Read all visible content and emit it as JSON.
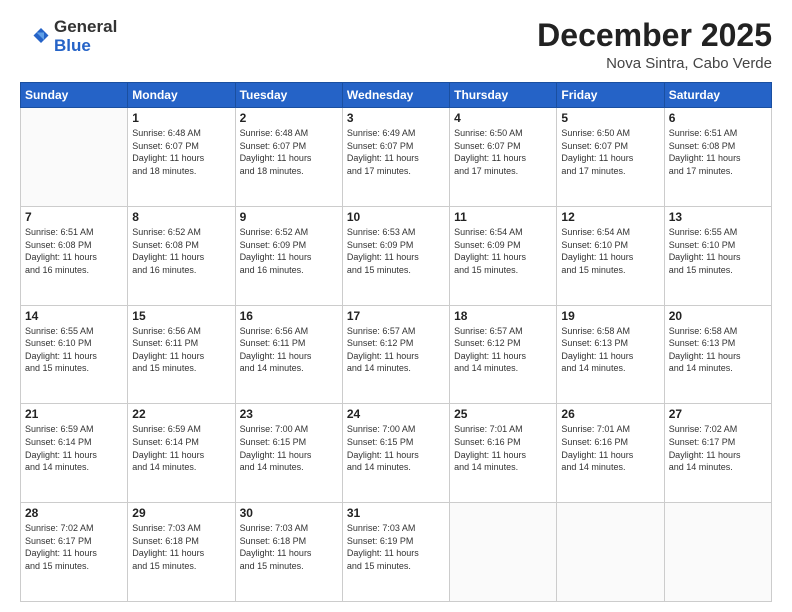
{
  "header": {
    "logo_general": "General",
    "logo_blue": "Blue",
    "month": "December 2025",
    "location": "Nova Sintra, Cabo Verde"
  },
  "weekdays": [
    "Sunday",
    "Monday",
    "Tuesday",
    "Wednesday",
    "Thursday",
    "Friday",
    "Saturday"
  ],
  "weeks": [
    [
      {
        "day": "",
        "info": ""
      },
      {
        "day": "1",
        "info": "Sunrise: 6:48 AM\nSunset: 6:07 PM\nDaylight: 11 hours\nand 18 minutes."
      },
      {
        "day": "2",
        "info": "Sunrise: 6:48 AM\nSunset: 6:07 PM\nDaylight: 11 hours\nand 18 minutes."
      },
      {
        "day": "3",
        "info": "Sunrise: 6:49 AM\nSunset: 6:07 PM\nDaylight: 11 hours\nand 17 minutes."
      },
      {
        "day": "4",
        "info": "Sunrise: 6:50 AM\nSunset: 6:07 PM\nDaylight: 11 hours\nand 17 minutes."
      },
      {
        "day": "5",
        "info": "Sunrise: 6:50 AM\nSunset: 6:07 PM\nDaylight: 11 hours\nand 17 minutes."
      },
      {
        "day": "6",
        "info": "Sunrise: 6:51 AM\nSunset: 6:08 PM\nDaylight: 11 hours\nand 17 minutes."
      }
    ],
    [
      {
        "day": "7",
        "info": "Sunrise: 6:51 AM\nSunset: 6:08 PM\nDaylight: 11 hours\nand 16 minutes."
      },
      {
        "day": "8",
        "info": "Sunrise: 6:52 AM\nSunset: 6:08 PM\nDaylight: 11 hours\nand 16 minutes."
      },
      {
        "day": "9",
        "info": "Sunrise: 6:52 AM\nSunset: 6:09 PM\nDaylight: 11 hours\nand 16 minutes."
      },
      {
        "day": "10",
        "info": "Sunrise: 6:53 AM\nSunset: 6:09 PM\nDaylight: 11 hours\nand 15 minutes."
      },
      {
        "day": "11",
        "info": "Sunrise: 6:54 AM\nSunset: 6:09 PM\nDaylight: 11 hours\nand 15 minutes."
      },
      {
        "day": "12",
        "info": "Sunrise: 6:54 AM\nSunset: 6:10 PM\nDaylight: 11 hours\nand 15 minutes."
      },
      {
        "day": "13",
        "info": "Sunrise: 6:55 AM\nSunset: 6:10 PM\nDaylight: 11 hours\nand 15 minutes."
      }
    ],
    [
      {
        "day": "14",
        "info": "Sunrise: 6:55 AM\nSunset: 6:10 PM\nDaylight: 11 hours\nand 15 minutes."
      },
      {
        "day": "15",
        "info": "Sunrise: 6:56 AM\nSunset: 6:11 PM\nDaylight: 11 hours\nand 15 minutes."
      },
      {
        "day": "16",
        "info": "Sunrise: 6:56 AM\nSunset: 6:11 PM\nDaylight: 11 hours\nand 14 minutes."
      },
      {
        "day": "17",
        "info": "Sunrise: 6:57 AM\nSunset: 6:12 PM\nDaylight: 11 hours\nand 14 minutes."
      },
      {
        "day": "18",
        "info": "Sunrise: 6:57 AM\nSunset: 6:12 PM\nDaylight: 11 hours\nand 14 minutes."
      },
      {
        "day": "19",
        "info": "Sunrise: 6:58 AM\nSunset: 6:13 PM\nDaylight: 11 hours\nand 14 minutes."
      },
      {
        "day": "20",
        "info": "Sunrise: 6:58 AM\nSunset: 6:13 PM\nDaylight: 11 hours\nand 14 minutes."
      }
    ],
    [
      {
        "day": "21",
        "info": "Sunrise: 6:59 AM\nSunset: 6:14 PM\nDaylight: 11 hours\nand 14 minutes."
      },
      {
        "day": "22",
        "info": "Sunrise: 6:59 AM\nSunset: 6:14 PM\nDaylight: 11 hours\nand 14 minutes."
      },
      {
        "day": "23",
        "info": "Sunrise: 7:00 AM\nSunset: 6:15 PM\nDaylight: 11 hours\nand 14 minutes."
      },
      {
        "day": "24",
        "info": "Sunrise: 7:00 AM\nSunset: 6:15 PM\nDaylight: 11 hours\nand 14 minutes."
      },
      {
        "day": "25",
        "info": "Sunrise: 7:01 AM\nSunset: 6:16 PM\nDaylight: 11 hours\nand 14 minutes."
      },
      {
        "day": "26",
        "info": "Sunrise: 7:01 AM\nSunset: 6:16 PM\nDaylight: 11 hours\nand 14 minutes."
      },
      {
        "day": "27",
        "info": "Sunrise: 7:02 AM\nSunset: 6:17 PM\nDaylight: 11 hours\nand 14 minutes."
      }
    ],
    [
      {
        "day": "28",
        "info": "Sunrise: 7:02 AM\nSunset: 6:17 PM\nDaylight: 11 hours\nand 15 minutes."
      },
      {
        "day": "29",
        "info": "Sunrise: 7:03 AM\nSunset: 6:18 PM\nDaylight: 11 hours\nand 15 minutes."
      },
      {
        "day": "30",
        "info": "Sunrise: 7:03 AM\nSunset: 6:18 PM\nDaylight: 11 hours\nand 15 minutes."
      },
      {
        "day": "31",
        "info": "Sunrise: 7:03 AM\nSunset: 6:19 PM\nDaylight: 11 hours\nand 15 minutes."
      },
      {
        "day": "",
        "info": ""
      },
      {
        "day": "",
        "info": ""
      },
      {
        "day": "",
        "info": ""
      }
    ]
  ]
}
